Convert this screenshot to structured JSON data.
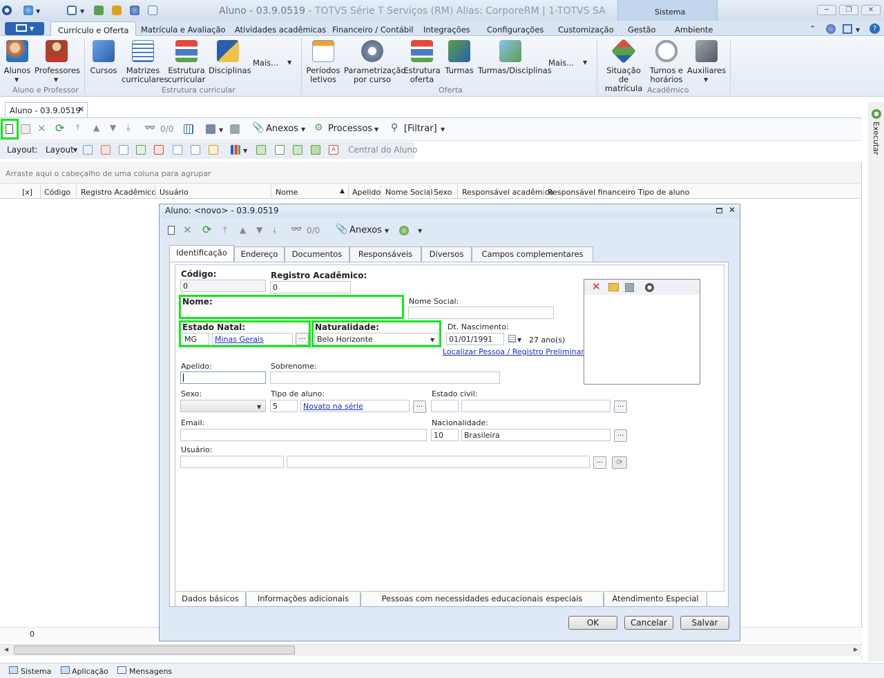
{
  "window": {
    "title": "Aluno - 03.9.0519",
    "title_rest": " - TOTVS Série T Serviços (RM) Alias: CorporeRM | 1-TOTVS SA"
  },
  "sistema_label": "Sistema",
  "ribbon_tabs": [
    "Currículo e Oferta",
    "Matrícula e Avaliação",
    "Atividades acadêmicas",
    "Financeiro / Contábil",
    "Integrações",
    "Configurações",
    "Customização",
    "Gestão",
    "Ambiente"
  ],
  "ribbon_groups": {
    "aluno_professor": {
      "label": "Aluno e Professor",
      "items": [
        "Alunos",
        "Professores"
      ]
    },
    "estrutura": {
      "label": "Estrutura curricular",
      "items": [
        "Cursos",
        "Matrizes curriculares",
        "Estrutura curricular",
        "Disciplinas",
        "Mais..."
      ]
    },
    "oferta": {
      "label": "Oferta",
      "items": [
        "Períodos letivos",
        "Parametrização por curso",
        "Estrutura oferta",
        "Turmas",
        "Turmas/Disciplinas",
        "Mais..."
      ]
    },
    "academico": {
      "label": "Acadêmico",
      "items": [
        "Situação de matrícula",
        "Turnos e horários",
        "Auxiliares"
      ]
    }
  },
  "doc_tab": "Aluno - 03.9.0519",
  "main_toolbar": {
    "counter": "0/0",
    "anexos": "Anexos",
    "processos": "Processos",
    "filtrar": "[Filtrar]"
  },
  "layout_bar": {
    "layout1": "Layout:",
    "layout2": "Layout",
    "central": "Central do Aluno"
  },
  "group_hint": "Arraste aqui o cabeçalho de uma coluna para agrupar",
  "columns": [
    "[x]",
    "Código",
    "Registro Acadêmico",
    "Usuário",
    "Nome",
    "Apelido",
    "Nome Social",
    "Sexo",
    "Responsável acadêmico",
    "Responsável financeiro",
    "Tipo de aluno"
  ],
  "grid_footer_count": "0",
  "right_panel": "Executar",
  "status_bar": [
    "Sistema",
    "Aplicação",
    "Mensagens"
  ],
  "dialog": {
    "title": "Aluno: <novo> - 03.9.0519",
    "counter": "0/0",
    "anexos": "Anexos",
    "tabs": [
      "Identificação",
      "Endereço",
      "Documentos",
      "Responsáveis",
      "Diversos",
      "Campos complementares"
    ],
    "bottom_tabs": [
      "Dados básicos",
      "Informações adicionais",
      "Pessoas com necessidades educacionais especiais",
      "Atendimento Especial"
    ],
    "buttons": {
      "ok": "OK",
      "cancelar": "Cancelar",
      "salvar": "Salvar"
    },
    "form": {
      "codigo": {
        "label": "Código:",
        "value": "0"
      },
      "registro": {
        "label": "Registro Acadêmico:",
        "value": "0"
      },
      "nome": {
        "label": "Nome:",
        "value": ""
      },
      "nome_social": {
        "label": "Nome Social:",
        "value": ""
      },
      "estado_natal": {
        "label": "Estado Natal:",
        "uf": "MG",
        "name": "Minas Gerais"
      },
      "naturalidade": {
        "label": "Naturalidade:",
        "value": "Belo Horizonte"
      },
      "nascimento": {
        "label": "Dt. Nascimento:",
        "value": "01/01/1991",
        "age": "27 ano(s)"
      },
      "localizar": "Localizar Pessoa / Registro Preliminar",
      "apelido": {
        "label": "Apelido:",
        "value": ""
      },
      "sobrenome": {
        "label": "Sobrenome:",
        "value": ""
      },
      "sexo": {
        "label": "Sexo:",
        "value": ""
      },
      "tipo_aluno": {
        "label": "Tipo de aluno:",
        "code": "5",
        "name": "Novato na série"
      },
      "estado_civil": {
        "label": "Estado civil:",
        "value": ""
      },
      "email": {
        "label": "Email:",
        "value": ""
      },
      "nacionalidade": {
        "label": "Nacionalidade:",
        "code": "10",
        "name": "Brasileira"
      },
      "usuario": {
        "label": "Usuário:",
        "value": ""
      }
    }
  },
  "colors": {
    "highlight": "#17e51e",
    "link": "#1a2fb4",
    "app_button": "#2b63b6"
  }
}
